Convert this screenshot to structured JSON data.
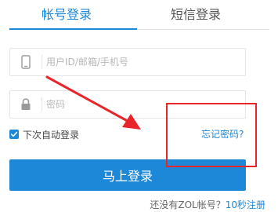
{
  "tabs": {
    "account_login": "帐号登录",
    "sms_login": "短信登录"
  },
  "form": {
    "username_placeholder": "用户ID/邮箱/手机号",
    "password_placeholder": "密码",
    "remember_label": "下次自动登录",
    "remember_checked": true,
    "forgot_label": "忘记密码?",
    "login_button": "马上登录"
  },
  "register": {
    "question": "还没有ZOL帐号？",
    "link": "10秒注册"
  },
  "icons": {
    "phone": "phone-icon",
    "lock": "lock-icon",
    "check": "check-icon"
  },
  "colors": {
    "accent": "#1e88d8",
    "annotation": "#e8262a"
  }
}
